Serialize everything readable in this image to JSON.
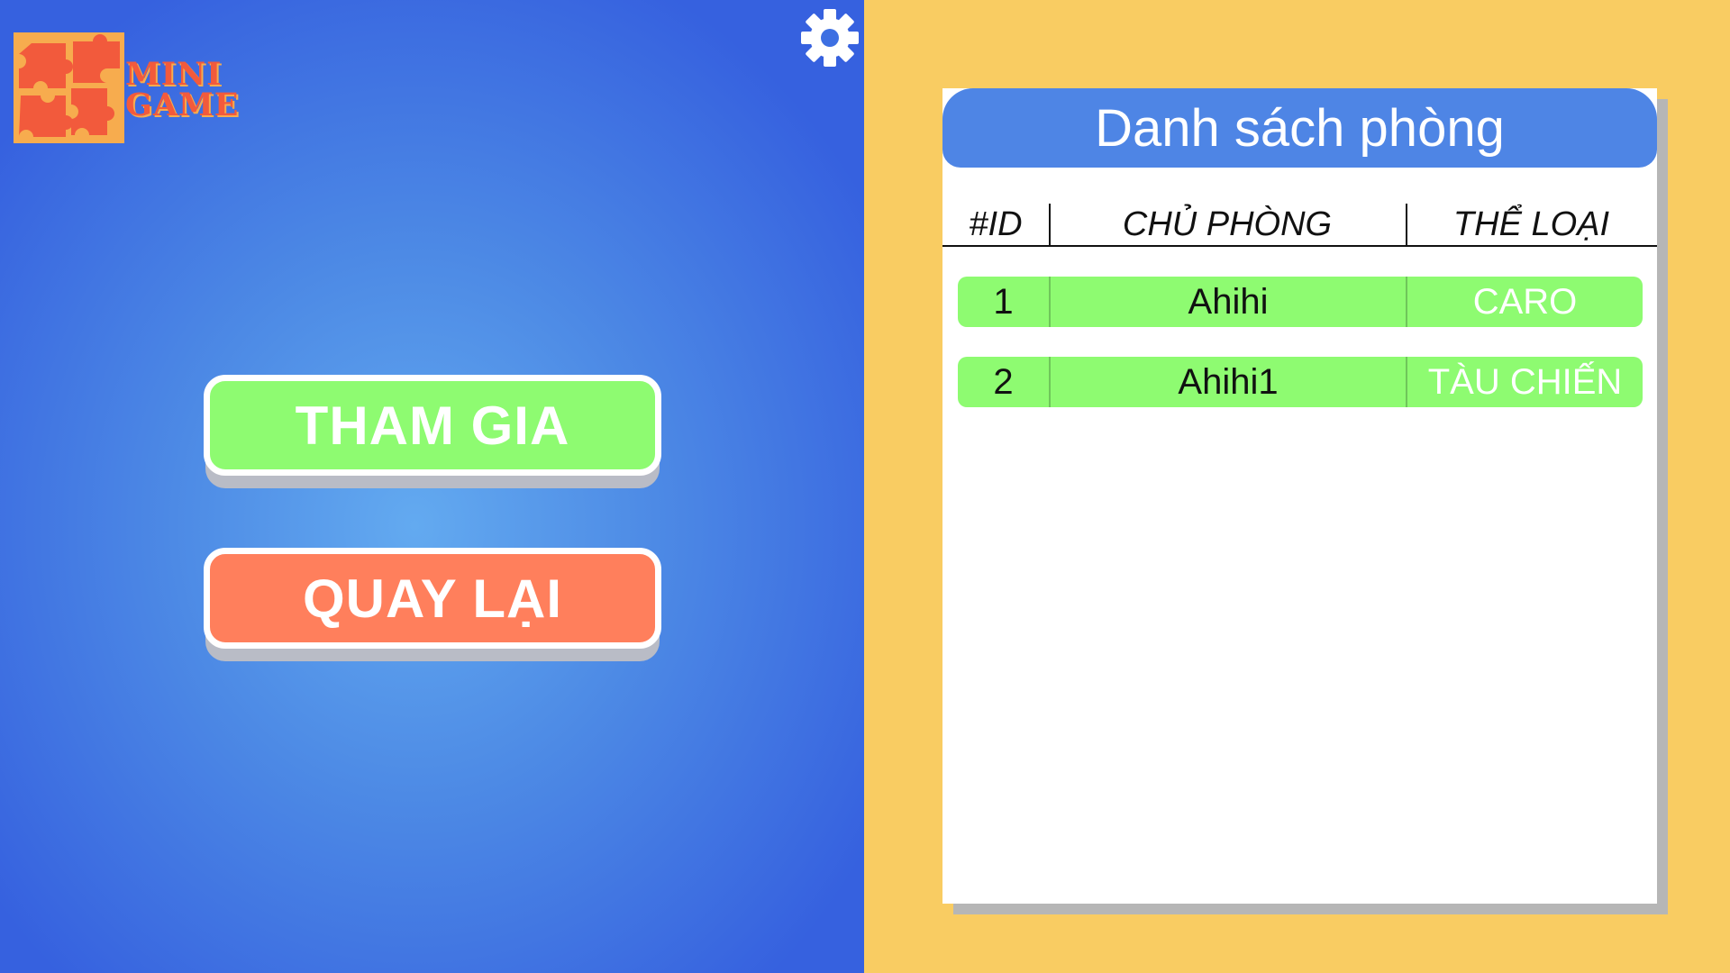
{
  "logo": {
    "line1": "MINI",
    "line2": "GAME"
  },
  "buttons": {
    "join": "THAM GIA",
    "back": "QUAY LẠI"
  },
  "room_list": {
    "title": "Danh sách phòng",
    "columns": [
      "#ID",
      "CHỦ PHÒNG",
      "THỂ LOẠI"
    ],
    "rows": [
      {
        "id": "1",
        "owner": "Ahihi",
        "category": "CARO"
      },
      {
        "id": "2",
        "owner": "Ahihi1",
        "category": "TÀU CHIẾN"
      }
    ]
  },
  "icons": {
    "settings": "gear-icon",
    "logo": "puzzle-icon"
  },
  "colors": {
    "left_bg": "#4d8ae5",
    "right_bg": "#f9cc62",
    "join_button": "#8efb71",
    "back_button": "#ff7f5c",
    "table_header": "#4e85e5",
    "row_bg": "#8efb71"
  }
}
